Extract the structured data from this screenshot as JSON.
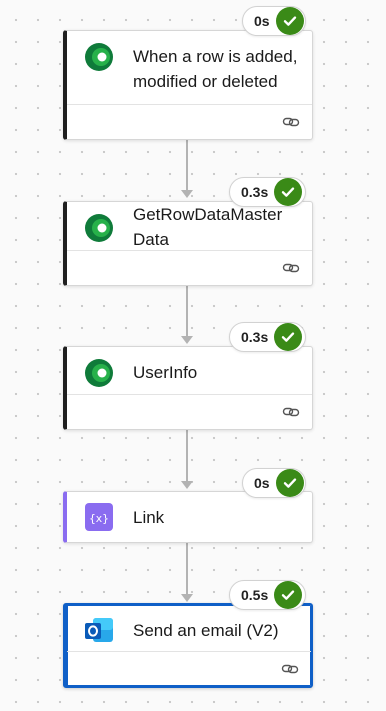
{
  "flow": {
    "steps": [
      {
        "title": "When a row is added, modified or deleted",
        "icon": "dataverse-icon",
        "duration": "0s",
        "status": "succeeded"
      },
      {
        "title": "GetRowDataMasterData",
        "icon": "dataverse-icon",
        "duration": "0.3s",
        "status": "succeeded"
      },
      {
        "title": "UserInfo",
        "icon": "dataverse-icon",
        "duration": "0.3s",
        "status": "succeeded"
      },
      {
        "title": "Link",
        "icon": "data-operation-compose-icon",
        "duration": "0s",
        "status": "succeeded"
      },
      {
        "title": "Send an email (V2)",
        "icon": "outlook-icon",
        "duration": "0.5s",
        "status": "succeeded",
        "selected": true
      }
    ]
  },
  "colors": {
    "canvas_background": "#fafafa",
    "success_green": "#3a8a17",
    "selected_border": "#0f5fc7",
    "compose_purple": "#8a6cf0",
    "dataverse_green": "#0f7b3a"
  }
}
